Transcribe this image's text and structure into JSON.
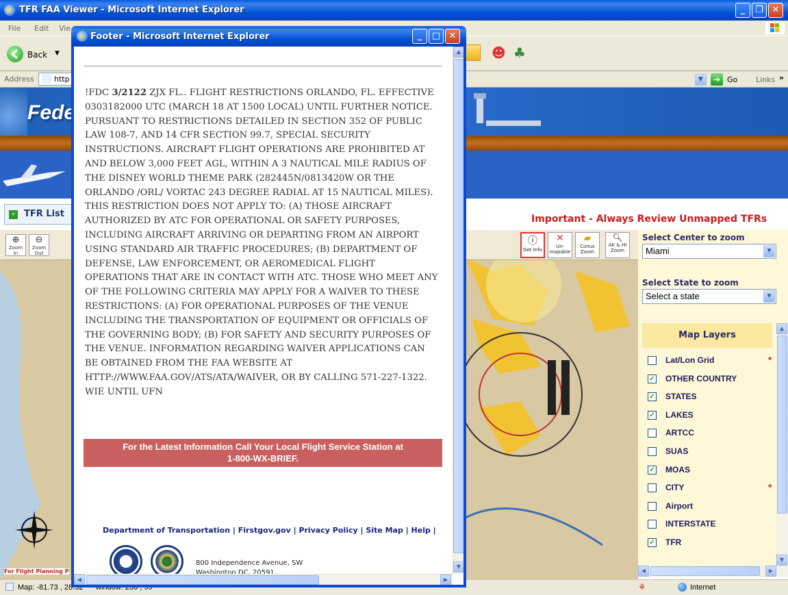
{
  "main_window": {
    "title": "TFR FAA Viewer - Microsoft Internet Explorer",
    "menu": [
      "File",
      "Edit",
      "Vie"
    ],
    "back_label": "Back",
    "address_label": "Address",
    "address_value": "http",
    "go_label": "Go",
    "links_label": "Links"
  },
  "page": {
    "header_title": "Fede",
    "tfr_list_label": "TFR List",
    "important_notice": "Important - Always Review Unmapped TFRs",
    "zoom_in_label": "Zoom In",
    "zoom_out_label": "Zoom Out",
    "map_tools": [
      "Get Info",
      "Un-mapable",
      "Conus Zoom",
      "AK & HI Zoom"
    ],
    "center_label": "Select Center to zoom",
    "center_value": "Miami",
    "state_label": "Select State to zoom",
    "state_value": "Select a state",
    "layers_title": "Map Layers",
    "layers": [
      {
        "label": "Lat/Lon Grid",
        "checked": false,
        "star": true
      },
      {
        "label": "OTHER COUNTRY",
        "checked": true,
        "star": false
      },
      {
        "label": "STATES",
        "checked": true,
        "star": false
      },
      {
        "label": "LAKES",
        "checked": true,
        "star": false
      },
      {
        "label": "ARTCC",
        "checked": false,
        "star": false
      },
      {
        "label": "SUAS",
        "checked": false,
        "star": false
      },
      {
        "label": "MOAS",
        "checked": true,
        "star": false
      },
      {
        "label": "CITY",
        "checked": false,
        "star": true
      },
      {
        "label": "Airport",
        "checked": false,
        "star": false
      },
      {
        "label": "INTERSTATE",
        "checked": false,
        "star": false
      },
      {
        "label": "TFR",
        "checked": true,
        "star": false
      }
    ],
    "map_left_caption": "For Flight Planning P"
  },
  "status": {
    "map_coords": "Map: -81.73 , 28.52",
    "window_coords": "window: 236 , 99",
    "zone": "Internet"
  },
  "popup": {
    "title": "Footer - Microsoft Internet Explorer",
    "notam_prefix": "!FDC",
    "notam_id": "3/2122",
    "notam_body": "ZJX FL.. FLIGHT RESTRICTIONS ORLANDO, FL. EFFECTIVE 0303182000 UTC (MARCH 18 AT 1500 LOCAL) UNTIL FURTHER NOTICE. PURSUANT TO RESTRICTIONS DETAILED IN SECTION 352 OF PUBLIC LAW 108-7, AND 14 CFR SECTION 99.7, SPECIAL SECURITY INSTRUCTIONS. AIRCRAFT FLIGHT OPERATIONS ARE PROHIBITED AT AND BELOW 3,000 FEET AGL, WITHIN A 3 NAUTICAL MILE RADIUS OF THE DISNEY WORLD THEME PARK (282445N/0813420W OR THE ORLANDO /ORL/ VORTAC 243 DEGREE RADIAL AT 15 NAUTICAL MILES). THIS RESTRICTION DOES NOT APPLY TO: (A) THOSE AIRCRAFT AUTHORIZED BY ATC FOR OPERATIONAL OR SAFETY PURPOSES, INCLUDING AIRCRAFT ARRIVING OR DEPARTING FROM AN AIRPORT USING STANDARD AIR TRAFFIC PROCEDURES; (B) DEPARTMENT OF DEFENSE, LAW ENFORCEMENT, OR AEROMEDICAL FLIGHT OPERATIONS THAT ARE IN CONTACT WITH ATC. THOSE WHO MEET ANY OF THE FOLLOWING CRITERIA MAY APPLY FOR A WAIVER TO THESE RESTRICTIONS: (A) FOR OPERATIONAL PURPOSES OF THE VENUE INCLUDING THE TRANSPORTATION OF EQUIPMENT OR OFFICIALS OF THE GOVERNING BODY; (B) FOR SAFETY AND SECURITY PURPOSES OF THE VENUE. INFORMATION REGARDING WAIVER APPLICATIONS CAN BE OBTAINED FROM THE FAA WEBSITE AT HTTP://WWW.FAA.GOV/ATS/ATA/WAIVER, OR BY CALLING 571-227-1322. WIE UNTIL UFN",
    "notice_line1": "For the Latest Information Call Your Local Flight Service Station at",
    "notice_line2": "1-800-WX-BRIEF.",
    "footer_links": [
      "Department of Transportation",
      "Firstgov.gov",
      "Privacy Policy",
      "Site Map",
      "Help"
    ],
    "link_separator": " | ",
    "address_line1": "800 Independence Avenue, SW",
    "address_line2": "Washington DC, 20591"
  }
}
